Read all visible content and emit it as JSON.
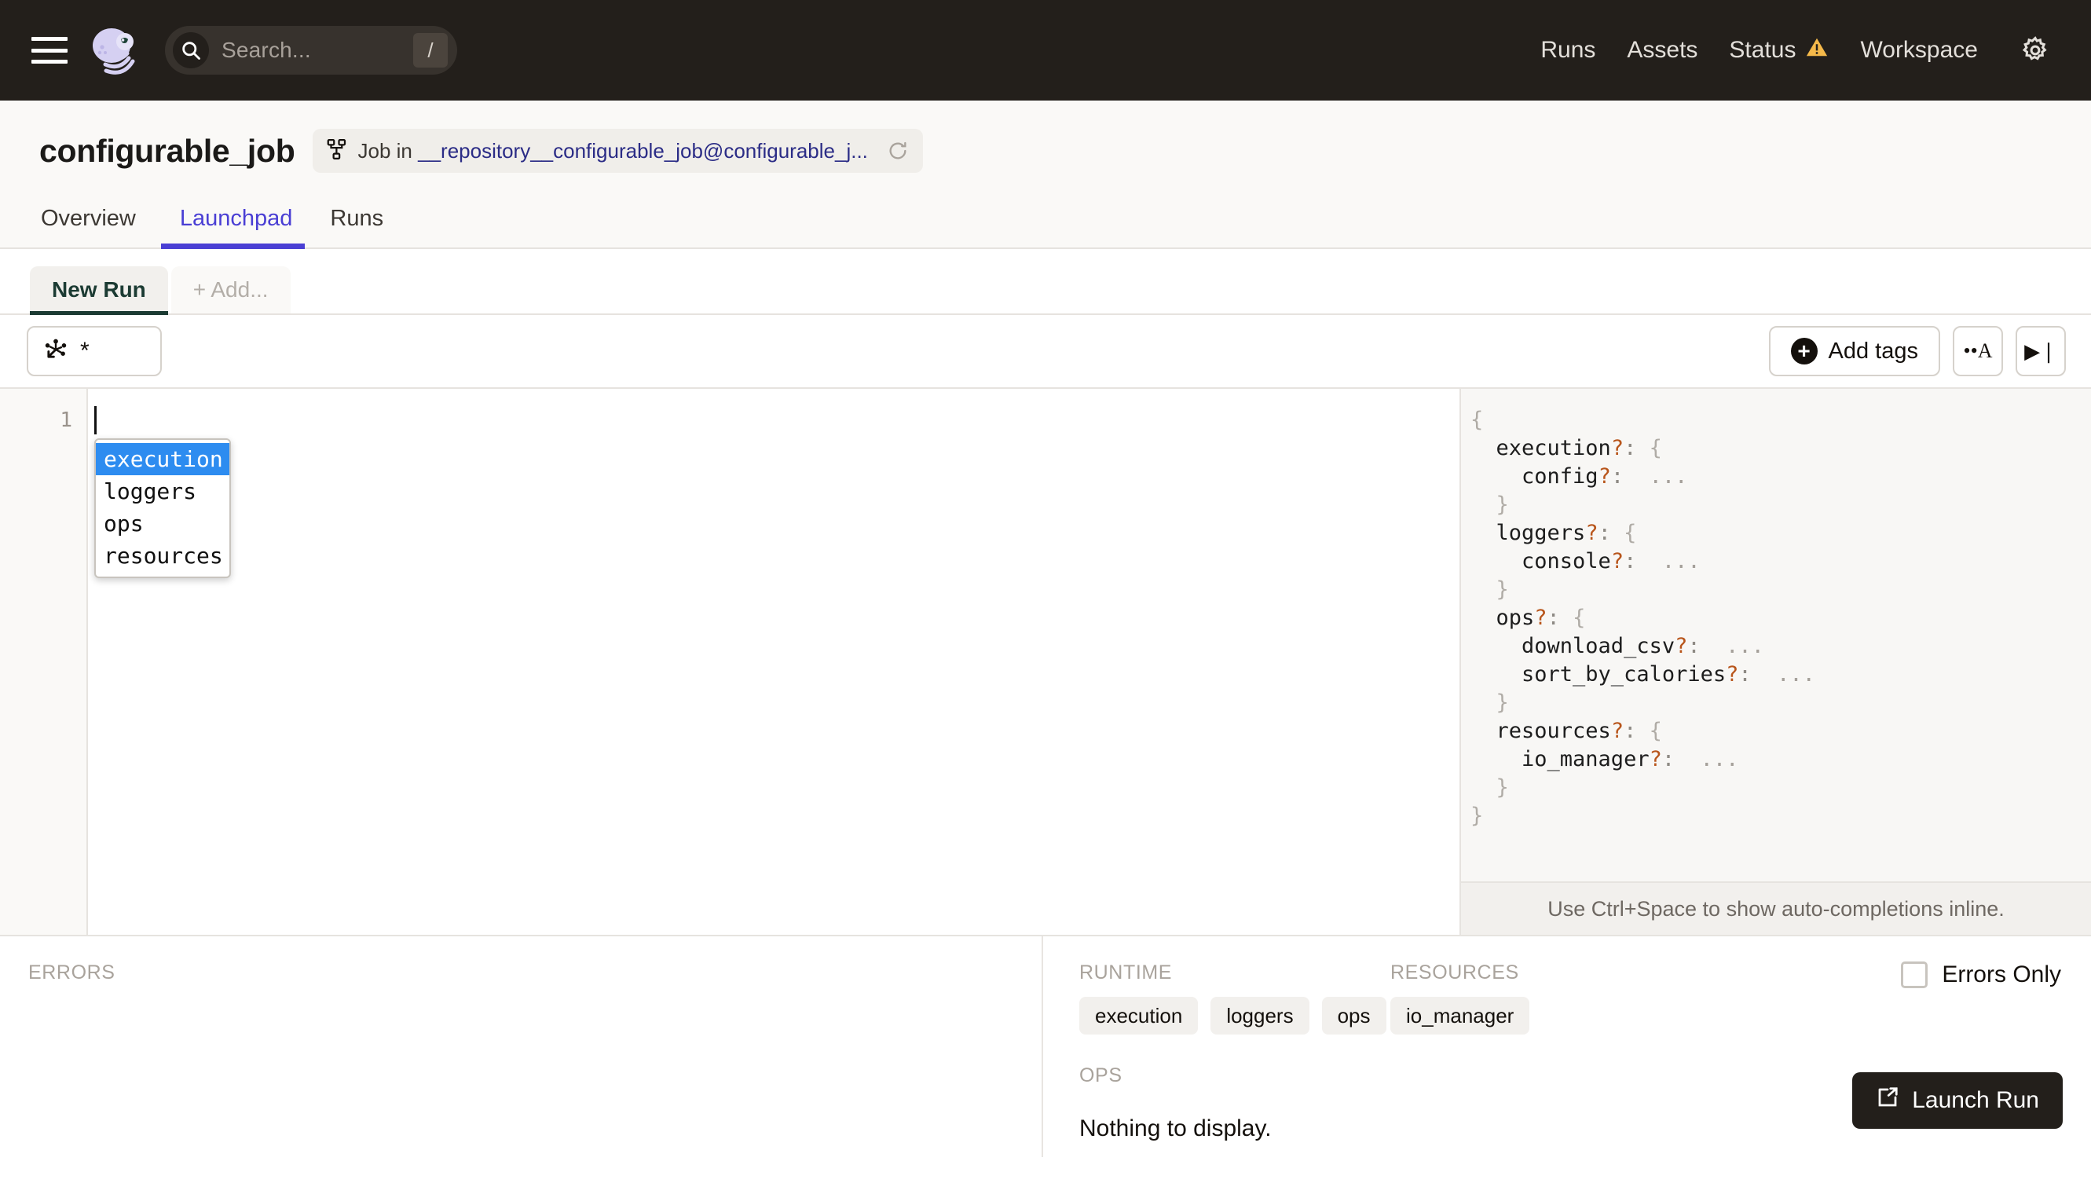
{
  "topnav": {
    "logo_name": "dagster-octopus-logo",
    "search_placeholder": "Search...",
    "search_shortcut": "/",
    "links": [
      {
        "label": "Runs",
        "warning": false
      },
      {
        "label": "Assets",
        "warning": false
      },
      {
        "label": "Status",
        "warning": true
      },
      {
        "label": "Workspace",
        "warning": false
      }
    ],
    "settings_icon": "gear-icon",
    "bg": "#231F1B"
  },
  "job": {
    "title": "configurable_job",
    "pill_prefix": "Job in ",
    "pill_link": "__repository__configurable_job@configurable_j...",
    "refresh_icon": "refresh-icon"
  },
  "tabs": [
    {
      "label": "Overview",
      "active": false
    },
    {
      "label": "Launchpad",
      "active": true
    },
    {
      "label": "Runs",
      "active": false
    }
  ],
  "session_tabs": [
    {
      "label": "New Run",
      "active": true
    },
    {
      "label": "+ Add...",
      "active": false
    }
  ],
  "toolbar": {
    "op_selection_value": "*",
    "op_selection_icon": "op-graph-icon",
    "add_tags_label": "Add tags",
    "font_size_button_label": "••A",
    "expand_button_label": "▶❘"
  },
  "editor": {
    "line_numbers": [
      "1"
    ],
    "content": "",
    "autocomplete": {
      "items": [
        "execution",
        "loggers",
        "ops",
        "resources"
      ],
      "selected_index": 0,
      "selected_bg": "#2D8CF0"
    }
  },
  "preview": {
    "lines": [
      {
        "indent": 0,
        "text": "{",
        "type": "brace"
      },
      {
        "indent": 1,
        "key": "execution",
        "optional": "?",
        "sep": ": ",
        "value": "{",
        "type": "open"
      },
      {
        "indent": 2,
        "key": "config",
        "optional": "?",
        "sep": ": ",
        "value": "...",
        "type": "leaf"
      },
      {
        "indent": 1,
        "text": "}",
        "type": "brace"
      },
      {
        "indent": 1,
        "key": "loggers",
        "optional": "?",
        "sep": ": ",
        "value": "{",
        "type": "open"
      },
      {
        "indent": 2,
        "key": "console",
        "optional": "?",
        "sep": ": ",
        "value": "...",
        "type": "leaf"
      },
      {
        "indent": 1,
        "text": "}",
        "type": "brace"
      },
      {
        "indent": 1,
        "key": "ops",
        "optional": "?",
        "sep": ": ",
        "value": "{",
        "type": "open"
      },
      {
        "indent": 2,
        "key": "download_csv",
        "optional": "?",
        "sep": ": ",
        "value": "...",
        "type": "leaf"
      },
      {
        "indent": 2,
        "key": "sort_by_calories",
        "optional": "?",
        "sep": ": ",
        "value": "...",
        "type": "leaf"
      },
      {
        "indent": 1,
        "text": "}",
        "type": "brace"
      },
      {
        "indent": 1,
        "key": "resources",
        "optional": "?",
        "sep": ": ",
        "value": "{",
        "type": "open"
      },
      {
        "indent": 2,
        "key": "io_manager",
        "optional": "?",
        "sep": ": ",
        "value": "...",
        "type": "leaf"
      },
      {
        "indent": 1,
        "text": "}",
        "type": "brace"
      },
      {
        "indent": 0,
        "text": "}",
        "type": "brace"
      }
    ],
    "hint": "Use Ctrl+Space to show auto-completions inline."
  },
  "footer": {
    "errors_label": "ERRORS",
    "runtime_label": "RUNTIME",
    "runtime_chips": [
      "execution",
      "loggers",
      "ops"
    ],
    "resources_label": "RESOURCES",
    "resources_chips": [
      "io_manager"
    ],
    "ops_label": "OPS",
    "ops_empty": "Nothing to display.",
    "errors_only_label": "Errors Only",
    "errors_only_checked": false,
    "launch_label": "Launch Run"
  }
}
